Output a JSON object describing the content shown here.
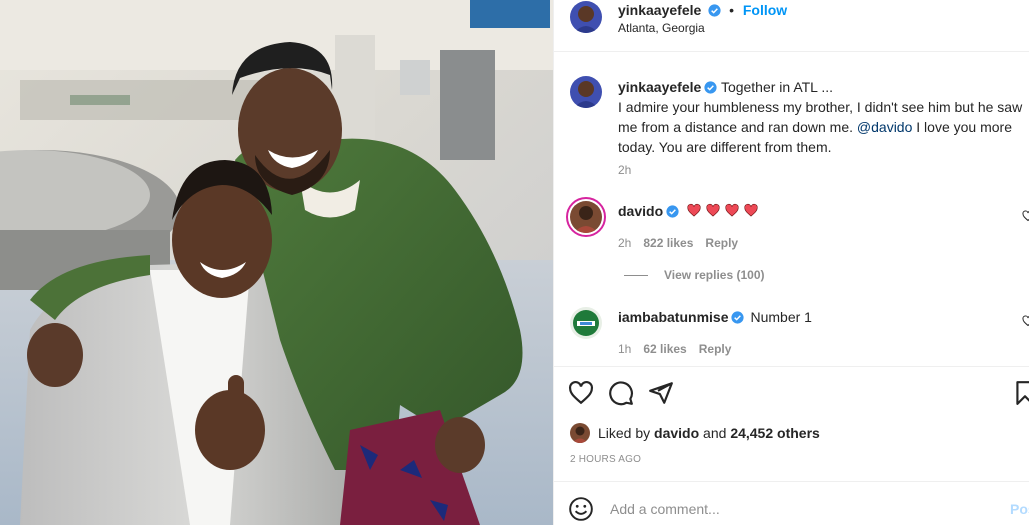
{
  "header": {
    "username": "yinkaayefele",
    "separator": "•",
    "follow_label": "Follow",
    "location": "Atlanta, Georgia"
  },
  "caption": {
    "username": "yinkaayefele",
    "text_part1": "Together in ATL ...\nI admire your humbleness my brother, I didn't see him but he saw me from a distance and ran down me. ",
    "mention": "@davido",
    "text_part2": " I love you more today. You are different from them.",
    "time": "2h"
  },
  "comments": [
    {
      "username": "davido",
      "text": "",
      "hearts": 4,
      "time": "2h",
      "likes": "822 likes",
      "reply_label": "Reply",
      "view_replies": "View replies (100)"
    },
    {
      "username": "iambabatunmise",
      "text": "Number 1",
      "time": "1h",
      "likes": "62 likes",
      "reply_label": "Reply"
    }
  ],
  "likes": {
    "prefix": "Liked by ",
    "user": "davido",
    "middle": " and ",
    "count": "24,452 others"
  },
  "timestamp": "2 HOURS AGO",
  "add_comment": {
    "placeholder": "Add a comment...",
    "post_label": "Post"
  },
  "colors": {
    "accent": "#0095f6",
    "heart": "#ed4956",
    "muted": "#8e8e8e"
  }
}
